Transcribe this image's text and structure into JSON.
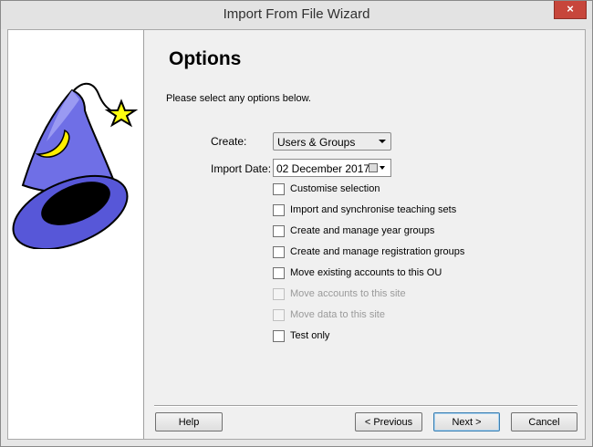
{
  "window": {
    "title": "Import From File Wizard",
    "close_label": "×"
  },
  "page": {
    "heading": "Options",
    "intro": "Please select any options below."
  },
  "form": {
    "create_label": "Create:",
    "create_value": "Users & Groups",
    "import_date_label": "Import Date:",
    "import_date_value": "02 December 2017"
  },
  "options": [
    {
      "label": "Customise selection",
      "checked": false,
      "enabled": true
    },
    {
      "label": "Import and synchronise teaching sets",
      "checked": false,
      "enabled": true
    },
    {
      "label": "Create and manage year groups",
      "checked": false,
      "enabled": true
    },
    {
      "label": "Create and manage registration groups",
      "checked": false,
      "enabled": true
    },
    {
      "label": "Move existing accounts to this OU",
      "checked": false,
      "enabled": true
    },
    {
      "label": "Move accounts to this site",
      "checked": false,
      "enabled": false
    },
    {
      "label": "Move data to this site",
      "checked": false,
      "enabled": false
    },
    {
      "label": "Test only",
      "checked": false,
      "enabled": true
    }
  ],
  "buttons": {
    "help": "Help",
    "previous": "< Previous",
    "next": "Next >",
    "cancel": "Cancel"
  },
  "icons": {
    "wizard": "wizard-hat-icon",
    "calendar": "calendar-icon",
    "dropdown": "chevron-down-icon"
  }
}
